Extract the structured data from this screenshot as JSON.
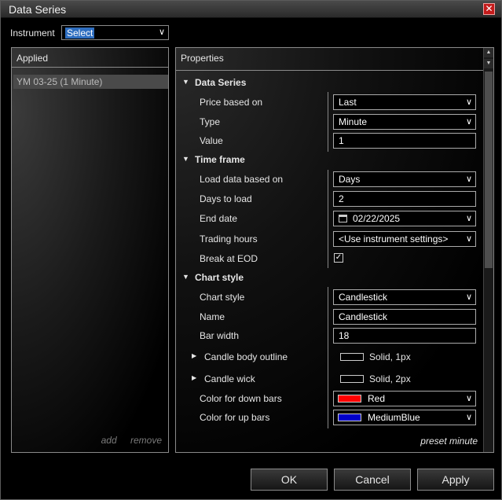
{
  "window": {
    "title": "Data Series"
  },
  "instrument": {
    "label": "Instrument",
    "value": "Select"
  },
  "applied": {
    "header": "Applied",
    "items": [
      "YM 03-25 (1 Minute)"
    ],
    "add_label": "add",
    "remove_label": "remove"
  },
  "properties": {
    "header": "Properties",
    "data_series": {
      "title": "Data Series",
      "price_based_on": {
        "label": "Price based on",
        "value": "Last"
      },
      "type": {
        "label": "Type",
        "value": "Minute"
      },
      "value": {
        "label": "Value",
        "value": "1"
      }
    },
    "time_frame": {
      "title": "Time frame",
      "load_data_based_on": {
        "label": "Load data based on",
        "value": "Days"
      },
      "days_to_load": {
        "label": "Days to load",
        "value": "2"
      },
      "end_date": {
        "label": "End date",
        "value": "02/22/2025"
      },
      "trading_hours": {
        "label": "Trading hours",
        "value": "<Use instrument settings>"
      },
      "break_at_eod": {
        "label": "Break at EOD",
        "checked": true
      }
    },
    "chart_style": {
      "title": "Chart style",
      "chart_style": {
        "label": "Chart style",
        "value": "Candlestick"
      },
      "name": {
        "label": "Name",
        "value": "Candlestick"
      },
      "bar_width": {
        "label": "Bar width",
        "value": "18"
      },
      "candle_body_outline": {
        "label": "Candle body outline",
        "value": "Solid, 1px"
      },
      "candle_wick": {
        "label": "Candle wick",
        "value": "Solid, 2px"
      },
      "color_down": {
        "label": "Color for down bars",
        "value": "Red",
        "color": "#ff0000"
      },
      "color_up": {
        "label": "Color for up bars",
        "value": "MediumBlue",
        "color": "#0000cd"
      }
    },
    "preset": "preset minute"
  },
  "buttons": {
    "ok": "OK",
    "cancel": "Cancel",
    "apply": "Apply"
  },
  "colors": {
    "accent": "#2e6ec0",
    "close": "#c41b1b"
  }
}
